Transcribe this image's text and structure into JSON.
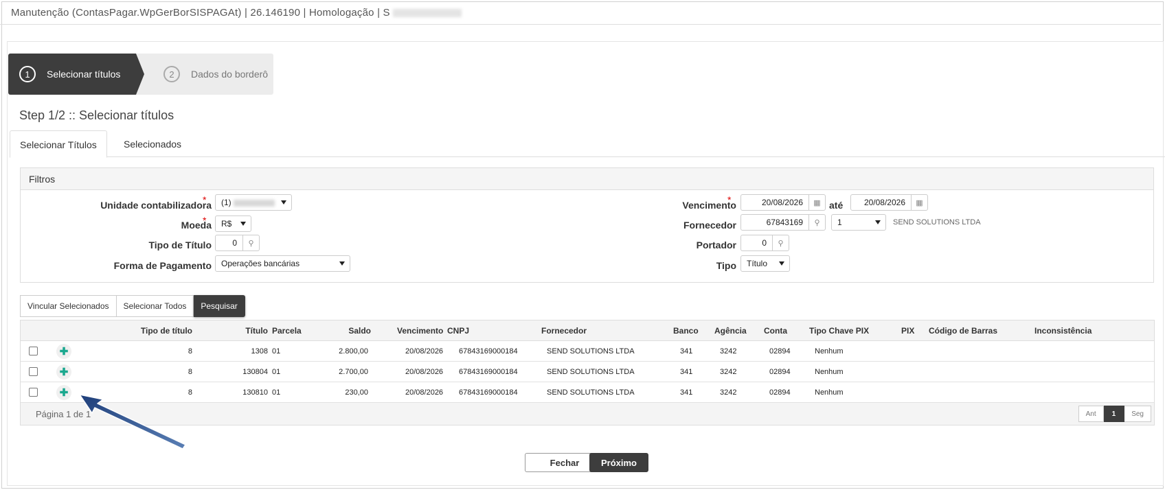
{
  "window": {
    "title": "Manutenção (ContasPagar.WpGerBorSISPAGAt) | 26.146190 | Homologação | S"
  },
  "wizard": {
    "steps": [
      {
        "num": "1",
        "label": "Selecionar títulos"
      },
      {
        "num": "2",
        "label": "Dados do borderô"
      }
    ]
  },
  "step_title": "Step 1/2 :: Selecionar títulos",
  "tabs": [
    "Selecionar Títulos",
    "Selecionados"
  ],
  "filters": {
    "title": "Filtros",
    "unidade_label": "Unidade contabilizadora",
    "unidade_value": "(1)",
    "moeda_label": "Moeda",
    "moeda_value": "R$",
    "tipo_titulo_label": "Tipo de Título",
    "tipo_titulo_value": "0",
    "forma_pagamento_label": "Forma de Pagamento",
    "forma_pagamento_value": "Operações bancárias",
    "vencimento_label": "Vencimento",
    "vencimento_de": "20/08/2026",
    "ate_label": "até",
    "vencimento_ate": "20/08/2026",
    "fornecedor_label": "Fornecedor",
    "fornecedor_code": "67843169",
    "fornecedor_select": "1",
    "fornecedor_name": "SEND SOLUTIONS LTDA",
    "portador_label": "Portador",
    "portador_value": "0",
    "tipo_label": "Tipo",
    "tipo_value": "Título",
    "required_mark": "*"
  },
  "actions": [
    "Vincular Selecionados",
    "Selecionar Todos",
    "Pesquisar"
  ],
  "table": {
    "headers": [
      "Tipo de título",
      "Título",
      "Parcela",
      "Saldo",
      "Vencimento",
      "CNPJ",
      "Fornecedor",
      "Banco",
      "Agência",
      "Conta",
      "Tipo Chave PIX",
      "PIX",
      "Código de Barras",
      "Inconsistência"
    ],
    "rows": [
      [
        "8",
        "1308",
        "01",
        "2.800,00",
        "20/08/2026",
        "67843169000184",
        "SEND SOLUTIONS LTDA",
        "341",
        "3242",
        "02894",
        "Nenhum"
      ],
      [
        "8",
        "130804",
        "01",
        "2.700,00",
        "20/08/2026",
        "67843169000184",
        "SEND SOLUTIONS LTDA",
        "341",
        "3242",
        "02894",
        "Nenhum"
      ],
      [
        "8",
        "130810",
        "01",
        "230,00",
        "20/08/2026",
        "67843169000184",
        "SEND SOLUTIONS LTDA",
        "341",
        "3242",
        "02894",
        "Nenhum"
      ]
    ],
    "page_info": "Página 1 de 1",
    "pager": [
      "Ant",
      "1",
      "Seg"
    ]
  },
  "footer": {
    "fechar": "Fechar",
    "proximo": "Próximo"
  },
  "colors": {
    "dark": "#3d3d3d",
    "accent": "#1aa88f",
    "arrow": "#1f3f7a",
    "required": "#dd0000"
  }
}
